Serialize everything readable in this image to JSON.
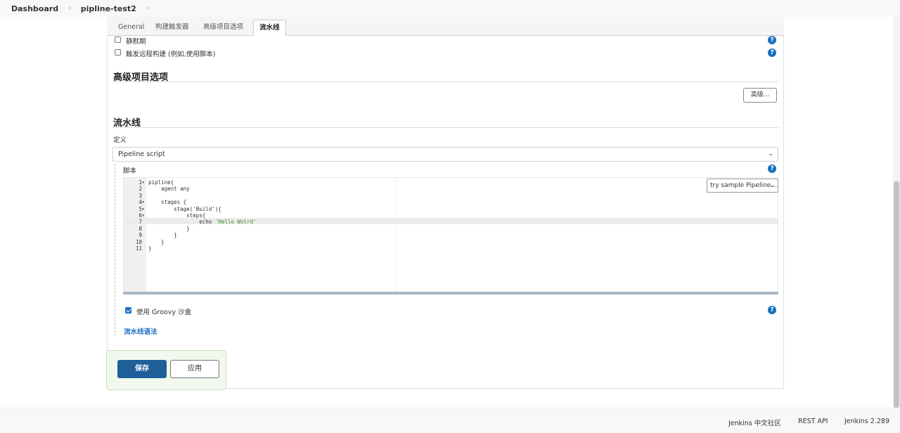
{
  "breadcrumb": {
    "home": "Dashboard",
    "job": "pipline-test2"
  },
  "tabs": [
    "General",
    "构建触发器",
    "高级项目选项",
    "流水线"
  ],
  "triggers": {
    "quiet_period": "静默期",
    "remote_trigger": "触发远程构建 (例如,使用脚本)"
  },
  "advanced": {
    "title": "高级项目选项",
    "button": "高级..."
  },
  "pipeline": {
    "title": "流水线",
    "definition_label": "定义",
    "definition_value": "Pipeline script",
    "script_label": "脚本",
    "sample_select": "try sample Pipeline...",
    "lines": [
      {
        "n": "1",
        "fold": true,
        "text": "pipline{"
      },
      {
        "n": "2",
        "fold": false,
        "text": "    agent any"
      },
      {
        "n": "3",
        "fold": false,
        "text": ""
      },
      {
        "n": "4",
        "fold": true,
        "text": "    stages {"
      },
      {
        "n": "5",
        "fold": true,
        "text": "        stage('Build'){"
      },
      {
        "n": "6",
        "fold": true,
        "text": "            steps{"
      },
      {
        "n": "7",
        "fold": false,
        "text": "                echo ",
        "str": "'Hello Wolrd'"
      },
      {
        "n": "8",
        "fold": false,
        "text": "            }"
      },
      {
        "n": "9",
        "fold": false,
        "text": "        }"
      },
      {
        "n": "10",
        "fold": false,
        "text": "    }"
      },
      {
        "n": "11",
        "fold": false,
        "text": "}"
      }
    ],
    "sandbox_label": "使用 Groovy 沙盒",
    "sandbox_checked": true,
    "syntax_link": "流水线语法"
  },
  "actions": {
    "save": "保存",
    "apply": "应用"
  },
  "footer": {
    "community": "Jenkins 中文社区",
    "rest_api": "REST API",
    "version": "Jenkins 2.289"
  },
  "icons": {
    "help": "?"
  }
}
